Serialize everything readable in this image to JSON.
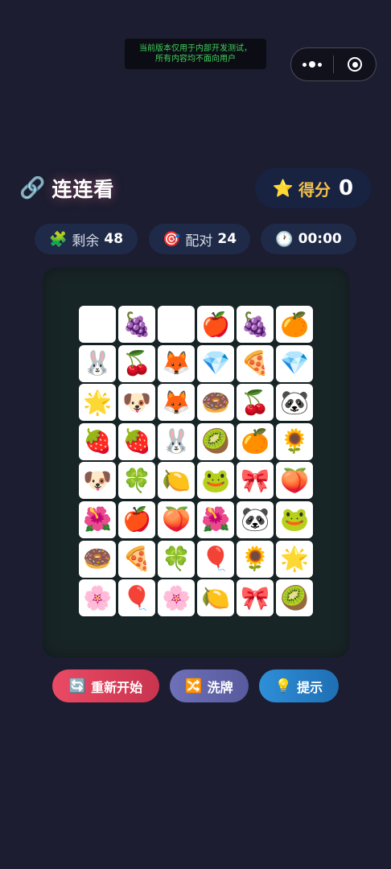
{
  "dev_notice": {
    "line1": "当前版本仅用于内部开发测试，",
    "line2": "所有内容均不面向用户"
  },
  "capsule": {
    "more_icon": "more-dots-icon",
    "close_icon": "target-close-icon"
  },
  "header": {
    "title_icon": "🔗",
    "title": "连连看",
    "score_icon": "⭐",
    "score_label": "得分",
    "score_value": "0"
  },
  "stats": {
    "remaining_icon": "🧩",
    "remaining_label": "剩余",
    "remaining_value": "48",
    "pairs_icon": "🎯",
    "pairs_label": "配对",
    "pairs_value": "24",
    "time_icon": "🕐",
    "time_value": "00:00"
  },
  "board": {
    "tiles": [
      "🐱",
      "🍇",
      "🐱",
      "🍎",
      "🍇",
      "🍊",
      "🐰",
      "🍒",
      "🦊",
      "💎",
      "🍕",
      "💎",
      "🌟",
      "🐶",
      "🦊",
      "🍩",
      "🍒",
      "🐼",
      "🍓",
      "🍓",
      "🐰",
      "🥝",
      "🍊",
      "🌻",
      "🐶",
      "🍀",
      "🍋",
      "🐸",
      "🎀",
      "🍑",
      "🌺",
      "🍎",
      "🍑",
      "🌺",
      "🐼",
      "🐸",
      "🍩",
      "🍕",
      "🍀",
      "🎈",
      "🌻",
      "🌟",
      "🌸",
      "🎈",
      "🌸",
      "🍋",
      "🎀",
      "🥝"
    ]
  },
  "actions": {
    "restart_icon": "🔄",
    "restart_label": "重新开始",
    "shuffle_icon": "🔀",
    "shuffle_label": "洗牌",
    "hint_icon": "💡",
    "hint_label": "提示"
  },
  "colors": {
    "background": "#1c1d30",
    "score_label": "#f2c04c",
    "restart": "#ea4a64",
    "shuffle": "#6e70b8",
    "hint": "#2e8fd8"
  }
}
